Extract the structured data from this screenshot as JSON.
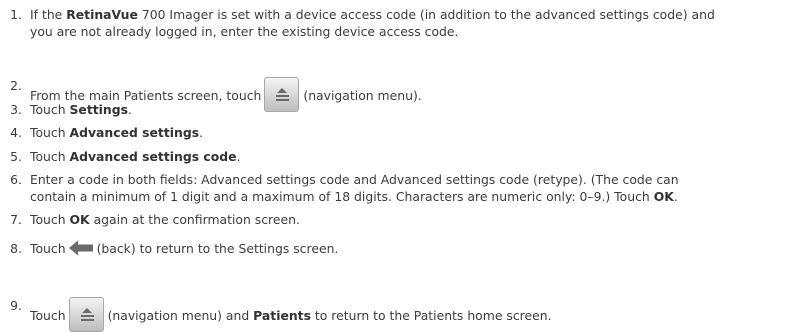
{
  "steps": [
    {
      "num": "1.",
      "line1_pre": "If the ",
      "line1_bold": "RetinaVue",
      "line1_post": " 700 Imager is set with a device access code (in addition to the advanced settings code) and",
      "line2": "you are not already logged in, enter the existing device access code."
    },
    {
      "num": "2.",
      "pre": "From the main Patients screen, touch",
      "icon": "navigation-menu-icon",
      "post": "(navigation menu)."
    },
    {
      "num": "3.",
      "pre": "Touch ",
      "bold": "Settings",
      "post": "."
    },
    {
      "num": "4.",
      "pre": "Touch ",
      "bold": "Advanced settings",
      "post": "."
    },
    {
      "num": "5.",
      "pre": "Touch ",
      "bold": "Advanced settings code",
      "post": "."
    },
    {
      "num": "6.",
      "line1": "Enter a code in both fields: Advanced settings code and Advanced settings code (retype). (The code can",
      "line2_pre": "contain a minimum of 1 digit and a maximum of 18 digits. Characters are numeric only: 0–9.) Touch ",
      "line2_bold": "OK",
      "line2_post": "."
    },
    {
      "num": "7.",
      "pre": "Touch ",
      "bold": "OK",
      "post": " again at the confirmation screen."
    },
    {
      "num": "8.",
      "pre": "Touch",
      "icon": "back-arrow-icon",
      "post": "(back) to return to the Settings screen."
    },
    {
      "num": "9.",
      "pre": "Touch",
      "icon": "navigation-menu-icon",
      "mid": "(navigation menu) and ",
      "bold": "Patients",
      "post": " to return to the Patients home screen."
    }
  ],
  "colors": {
    "text": "#3c3c3c",
    "icon_gray": "#6a6a6a"
  }
}
